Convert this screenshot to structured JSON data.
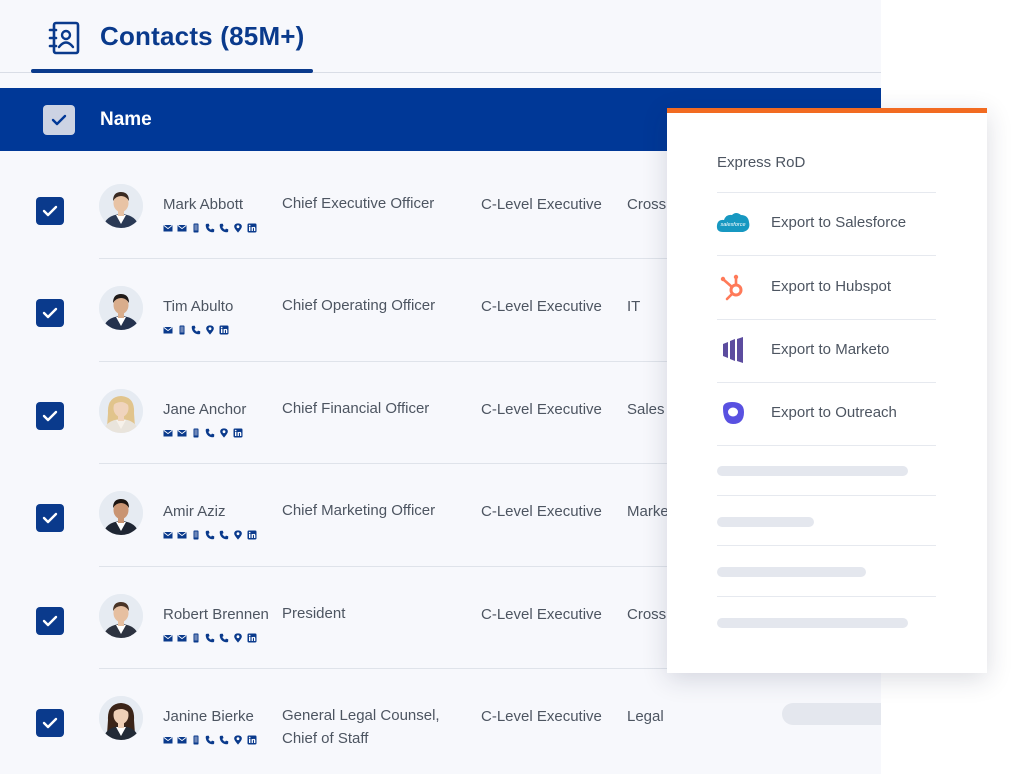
{
  "header": {
    "tab_title": "Contacts (85M+)"
  },
  "table": {
    "name_header": "Name"
  },
  "contacts": [
    {
      "name": "Mark Abbott",
      "title": "Chief Executive Officer",
      "level": "C-Level Executive",
      "dept": "Cross",
      "icons": [
        "email-icon",
        "email-icon",
        "mobile-icon",
        "phone-icon",
        "phone-icon",
        "location-icon",
        "linkedin-icon"
      ]
    },
    {
      "name": "Tim Abulto",
      "title": "Chief Operating Officer",
      "level": "C-Level Executive",
      "dept": "IT",
      "icons": [
        "email-icon",
        "mobile-icon",
        "phone-icon",
        "location-icon",
        "linkedin-icon"
      ]
    },
    {
      "name": "Jane Anchor",
      "title": "Chief Financial Officer",
      "level": "C-Level Executive",
      "dept": "Sales",
      "icons": [
        "email-icon",
        "email-icon",
        "mobile-icon",
        "phone-icon",
        "location-icon",
        "linkedin-icon"
      ]
    },
    {
      "name": "Amir Aziz",
      "title": "Chief Marketing Officer",
      "level": "C-Level Executive",
      "dept": "Marke",
      "icons": [
        "email-icon",
        "email-icon",
        "mobile-icon",
        "phone-icon",
        "phone-icon",
        "location-icon",
        "linkedin-icon"
      ]
    },
    {
      "name": "Robert Brennen",
      "title": "President",
      "level": "C-Level Executive",
      "dept": "Cross",
      "icons": [
        "email-icon",
        "email-icon",
        "mobile-icon",
        "phone-icon",
        "phone-icon",
        "location-icon",
        "linkedin-icon"
      ]
    },
    {
      "name": "Janine Bierke",
      "title": "General Legal Counsel,",
      "title_line2": "Chief of Staff",
      "level": "C-Level Executive",
      "dept": "Legal",
      "icons": [
        "email-icon",
        "email-icon",
        "mobile-icon",
        "phone-icon",
        "phone-icon",
        "location-icon",
        "linkedin-icon"
      ]
    }
  ],
  "export_menu": {
    "header": "Express RoD",
    "items": [
      {
        "label": "Export to Salesforce",
        "logo": "salesforce-logo-icon",
        "color": "#1798c1"
      },
      {
        "label": "Export to Hubspot",
        "logo": "hubspot-logo-icon",
        "color": "#ff7a59"
      },
      {
        "label": "Export to Marketo",
        "logo": "marketo-logo-icon",
        "color": "#5c4c9f"
      },
      {
        "label": "Export to Outreach",
        "logo": "outreach-logo-icon",
        "color": "#5951e1"
      }
    ]
  },
  "colors": {
    "primary": "#003897",
    "accent": "#f26b21",
    "text": "#4d5561"
  }
}
